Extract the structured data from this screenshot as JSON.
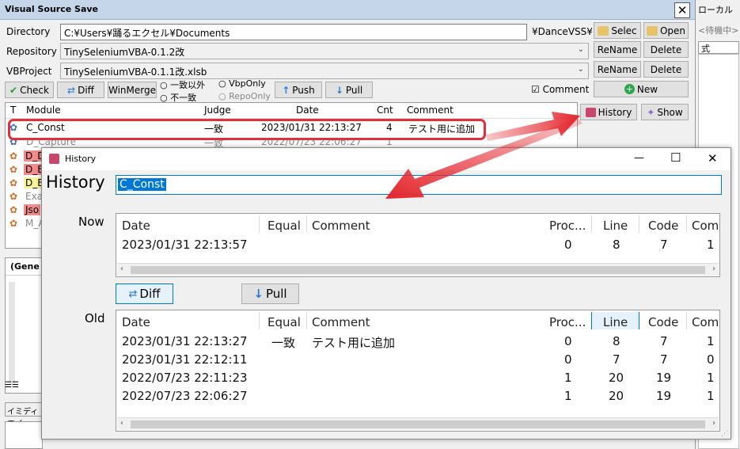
{
  "main": {
    "title": "Visual Source Save",
    "close_glyph": "✕",
    "directory_label": "Directory",
    "directory_value": "C:¥Users¥踊るエクセル¥Documents",
    "directory_suffix": "¥DanceVSS¥",
    "repository_label": "Repository",
    "repository_value": "TinySeleniumVBA-0.1.2改",
    "vbproject_label": "VBProject",
    "vbproject_value": "TinySeleniumVBA-0.1.1改.xlsb",
    "select_label": "Selec",
    "open_label": "Open",
    "rename_label": "ReName",
    "delete_label": "Delete",
    "check_label": "Check",
    "diff_label": "Diff",
    "winmerge_label": "WinMerge",
    "radio_except": "一致以外",
    "radio_mismatch": "不一致",
    "radio_vbponly": "VbpOnly",
    "radio_repoonly": "RepoOnly",
    "push_label": "Push",
    "pull_label": "Pull",
    "comment_checkbox_label": "Comment",
    "new_label": "New",
    "history_label": "History",
    "show_label": "Show",
    "list_headers": {
      "t": "T",
      "module": "Module",
      "judge": "Judge",
      "date": "Date",
      "cnt": "Cnt",
      "comment": "Comment"
    },
    "list_rows": [
      {
        "module": "C_Const",
        "judge": "一致",
        "date": "2023/01/31 22:13:27",
        "cnt": "4",
        "comment": "テスト用に追加"
      },
      {
        "module": "D_Capture",
        "judge": "一致",
        "date": "2022/07/23 22:06:27",
        "cnt": "1",
        "comment": ""
      },
      {
        "module": "D_D",
        "judge": "",
        "date": "",
        "cnt": "",
        "comment": ""
      },
      {
        "module": "D_E",
        "judge": "",
        "date": "",
        "cnt": "",
        "comment": ""
      },
      {
        "module": "D_E",
        "judge": "",
        "date": "",
        "cnt": "",
        "comment": ""
      },
      {
        "module": "Exa",
        "judge": "",
        "date": "",
        "cnt": "",
        "comment": ""
      },
      {
        "module": "Jso",
        "judge": "",
        "date": "",
        "cnt": "",
        "comment": ""
      },
      {
        "module": "M_A",
        "judge": "",
        "date": "",
        "cnt": "",
        "comment": ""
      }
    ],
    "general_label": "(Gene",
    "immediate_label": "イミディエイ"
  },
  "rightpane": {
    "title": "ローカル",
    "waiting": "<待機中>",
    "expr_header": "式"
  },
  "history_dialog": {
    "window_title": "History",
    "min_glyph": "—",
    "max_glyph": "☐",
    "close_glyph": "✕",
    "heading": "History",
    "module_value": "C_Const",
    "now_label": "Now",
    "old_label": "Old",
    "diff_label": "Diff",
    "pull_label": "Pull",
    "columns": {
      "date": "Date",
      "equal": "Equal",
      "comment": "Comment",
      "proc": "Proc...",
      "line": "Line",
      "code": "Code",
      "com": "Com"
    },
    "now_rows": [
      {
        "date": "2023/01/31 22:13:57",
        "equal": "",
        "comment": "",
        "proc": "0",
        "line": "8",
        "code": "7",
        "com": "1"
      }
    ],
    "old_rows": [
      {
        "date": "2023/01/31 22:13:27",
        "equal": "一致",
        "comment": "テスト用に追加",
        "proc": "0",
        "line": "8",
        "code": "7",
        "com": "1"
      },
      {
        "date": "2023/01/31 22:12:11",
        "equal": "",
        "comment": "",
        "proc": "0",
        "line": "7",
        "code": "7",
        "com": "0"
      },
      {
        "date": "2022/07/23 22:11:23",
        "equal": "",
        "comment": "",
        "proc": "1",
        "line": "20",
        "code": "19",
        "com": "1"
      },
      {
        "date": "2022/07/23 22:06:27",
        "equal": "",
        "comment": "",
        "proc": "1",
        "line": "20",
        "code": "19",
        "com": "1"
      }
    ]
  },
  "colors": {
    "accent": "#0078d7",
    "arrow": "#e3262d",
    "highlight": "#e0303a",
    "row_red": "#f28b8b"
  }
}
